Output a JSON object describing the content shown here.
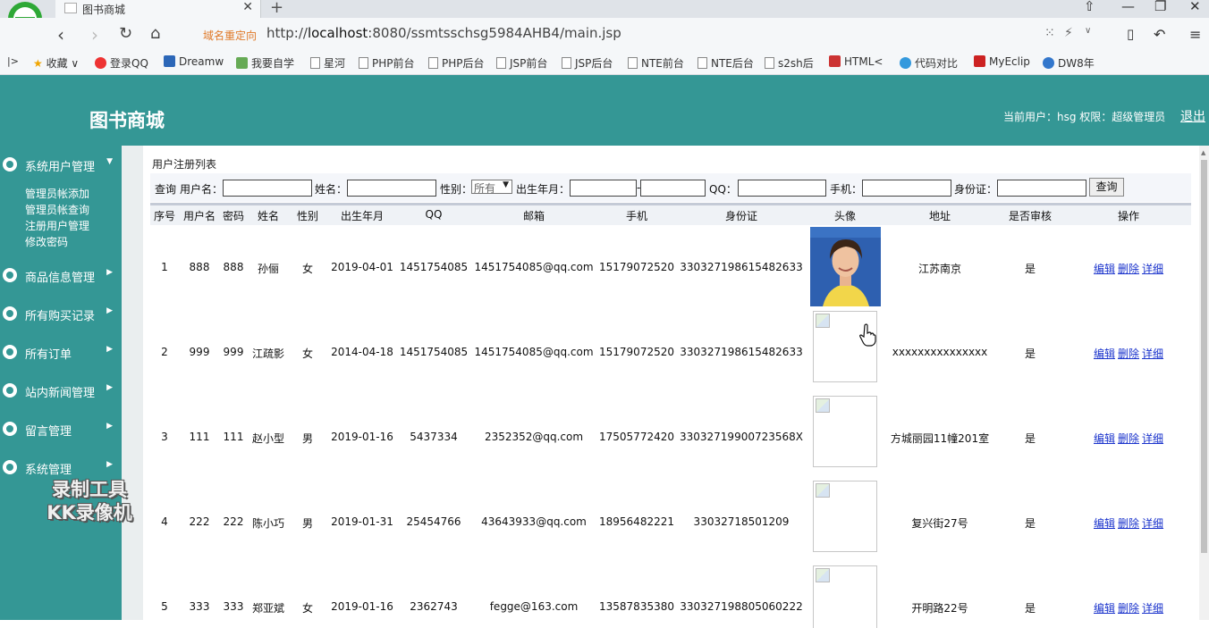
{
  "browser": {
    "tab_title": "图书商城",
    "redirect_label": "域名重定向",
    "url_prefix": "http://",
    "url_host": "localhost",
    "url_rest": ":8080/ssmtsschsg5984AHB4/main.jsp",
    "bookmarks": [
      "收藏",
      "登录QQ",
      "Dreamw",
      "我要自学",
      "星河",
      "PHP前台",
      "PHP后台",
      "JSP前台",
      "JSP后台",
      "NTE前台",
      "NTE后台",
      "s2sh后",
      "HTML<",
      "代码对比",
      "MyEclip",
      "DW8年"
    ]
  },
  "header": {
    "site_title": "图书商城",
    "user_info": "当前用户：hsg 权限：超级管理员",
    "logout": "退出"
  },
  "sidebar": {
    "menus": [
      {
        "label": "系统用户管理",
        "arrow": "▼"
      },
      {
        "label": "商品信息管理",
        "arrow": "▶"
      },
      {
        "label": "所有购买记录",
        "arrow": "▶"
      },
      {
        "label": "所有订单",
        "arrow": "▶"
      },
      {
        "label": "站内新闻管理",
        "arrow": "▶"
      },
      {
        "label": "留言管理",
        "arrow": "▶"
      },
      {
        "label": "系统管理",
        "arrow": "▶"
      }
    ],
    "submenu": [
      "管理员帐添加",
      "管理员帐查询",
      "注册用户管理",
      "修改密码"
    ],
    "watermark_line1": "录制工具",
    "watermark_line2": "KK录像机"
  },
  "panel": {
    "title": "用户注册列表"
  },
  "search": {
    "query_label": "查询",
    "username_label": "用户名：",
    "name_label": "姓名：",
    "gender_label": "性别：",
    "gender_selected": "所有",
    "birth_label": "出生年月：",
    "dash": "-",
    "qq_label": "QQ：",
    "phone_label": "手机：",
    "id_label": "身份证：",
    "button": "查询"
  },
  "table": {
    "headers": [
      "序号",
      "用户名",
      "密码",
      "姓名",
      "性别",
      "出生年月",
      "QQ",
      "邮箱",
      "手机",
      "身份证",
      "头像",
      "地址",
      "是否审核",
      "操作"
    ],
    "rows": [
      {
        "no": "1",
        "username": "888",
        "password": "888",
        "name": "孙俪",
        "gender": "女",
        "birth": "2019-04-01",
        "qq": "1451754085",
        "email": "1451754085@qq.com",
        "phone": "15179072520",
        "idcard": "330327198615482633",
        "address": "江苏南京",
        "audited": "是"
      },
      {
        "no": "2",
        "username": "999",
        "password": "999",
        "name": "江疏影",
        "gender": "女",
        "birth": "2014-04-18",
        "qq": "1451754085",
        "email": "1451754085@qq.com",
        "phone": "15179072520",
        "idcard": "330327198615482633",
        "address": "xxxxxxxxxxxxxxx",
        "audited": "是"
      },
      {
        "no": "3",
        "username": "111",
        "password": "111",
        "name": "赵小型",
        "gender": "男",
        "birth": "2019-01-16",
        "qq": "5437334",
        "email": "2352352@qq.com",
        "phone": "17505772420",
        "idcard": "330327199007235​68X",
        "address": "方城丽园11幢201室",
        "audited": "是"
      },
      {
        "no": "4",
        "username": "222",
        "password": "222",
        "name": "陈小巧",
        "gender": "男",
        "birth": "2019-01-31",
        "qq": "25454766",
        "email": "43643933@qq.com",
        "phone": "18956482221",
        "idcard": "33032718501209",
        "address": "复兴街27号",
        "audited": "是"
      },
      {
        "no": "5",
        "username": "333",
        "password": "333",
        "name": "郑亚斌",
        "gender": "女",
        "birth": "2019-01-16",
        "qq": "2362743",
        "email": "fegge@163.com",
        "phone": "13587835380",
        "idcard": "330327198805060222",
        "address": "开明路22号",
        "audited": "是"
      }
    ],
    "ops": {
      "edit": "编辑",
      "delete": "删除",
      "detail": "详细"
    }
  },
  "colors": {
    "theme": "#349795",
    "link": "#1a33cc"
  }
}
